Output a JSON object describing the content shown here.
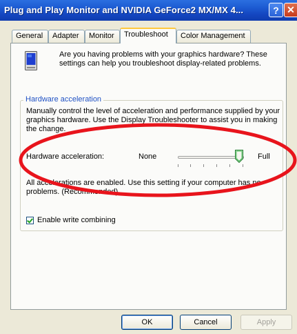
{
  "window": {
    "title": "Plug and Play Monitor and NVIDIA GeForce2 MX/MX 4...",
    "help_glyph": "?",
    "close_glyph": "✕"
  },
  "tabs": [
    "General",
    "Adapter",
    "Monitor",
    "Troubleshoot",
    "Color Management"
  ],
  "active_tab": "Troubleshoot",
  "intro_text": "Are you having problems with your graphics hardware? These settings can help you troubleshoot display-related problems.",
  "hardware_acceleration": {
    "group_title": "Hardware acceleration",
    "description": "Manually control the level of acceleration and performance supplied by your graphics hardware. Use the Display Troubleshooter to assist you in making the change.",
    "label": "Hardware acceleration:",
    "min_label": "None",
    "max_label": "Full",
    "level_fraction": 1.0,
    "status_text": "All accelerations are enabled. Use this setting if your computer has no problems. (Recommended)"
  },
  "write_combining": {
    "label": "Enable write combining",
    "checked": true
  },
  "buttons": {
    "ok": "OK",
    "cancel": "Cancel",
    "apply": "Apply"
  },
  "colors": {
    "annotation": "#e8141c",
    "titlebar": "#1d5cd3"
  }
}
